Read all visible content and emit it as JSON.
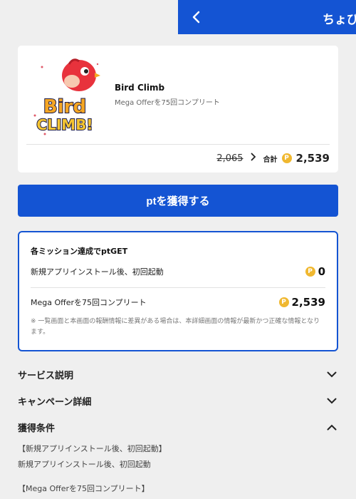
{
  "header": {
    "title": "ちょびリッチ"
  },
  "offer": {
    "app_name": "Bird Climb",
    "subtitle": "Mega Offerを75回コンプリート",
    "logo_text_1": "Bird",
    "logo_text_2": "CLIMB!",
    "old_price": "2,065",
    "total_label": "合計",
    "coin_symbol": "P",
    "total_value": "2,539"
  },
  "cta": {
    "label": "ptを獲得する"
  },
  "missions": {
    "title": "各ミッション達成でptGET",
    "items": [
      {
        "label": "新規アプリインストール後、初回起動",
        "value": "0"
      },
      {
        "label": "Mega Offerを75回コンプリート",
        "value": "2,539"
      }
    ],
    "note": "※ 一覧画面と本画面の報酬情報に差異がある場合は、本詳細画面の情報が最新かつ正確な情報となります。"
  },
  "sections": [
    {
      "title": "サービス説明",
      "expanded": false
    },
    {
      "title": "キャンペーン詳細",
      "expanded": false
    },
    {
      "title": "獲得条件",
      "expanded": true
    }
  ],
  "conditions": {
    "lines": [
      "【新規アプリインストール後、初回起動】",
      "新規アプリインストール後、初回起動",
      "【Mega Offerを75回コンプリート】"
    ]
  },
  "colors": {
    "primary": "#1454d3",
    "coin": "#f0b830",
    "background": "#efefef"
  }
}
